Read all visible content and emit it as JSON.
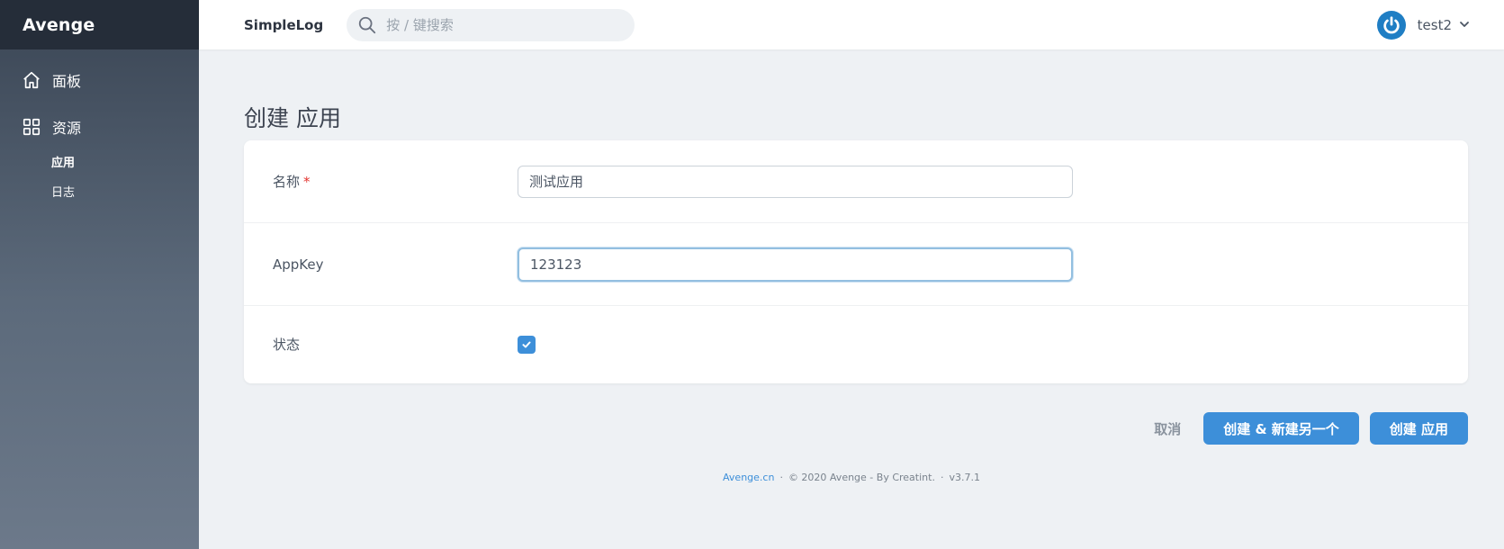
{
  "brand": "Avenge",
  "sidebar": {
    "items": [
      {
        "label": "面板",
        "icon": "home-icon"
      },
      {
        "label": "资源",
        "icon": "grid-icon"
      }
    ],
    "sub_items": [
      {
        "label": "应用",
        "active": true
      },
      {
        "label": "日志",
        "active": false
      }
    ]
  },
  "topbar": {
    "app_name": "SimpleLog",
    "search_placeholder": "按 / 键搜索",
    "user_name": "test2"
  },
  "page": {
    "title": "创建 应用"
  },
  "form": {
    "name_label": "名称",
    "required_mark": "*",
    "name_value": "测试应用",
    "appkey_label": "AppKey",
    "appkey_value": "123123",
    "status_label": "状态",
    "status_checked": true
  },
  "actions": {
    "cancel": "取消",
    "create_another": "创建 & 新建另一个",
    "create": "创建 应用"
  },
  "footer": {
    "link": "Avenge.cn",
    "separator": "·",
    "copyright": "© 2020 Avenge - By Creatint.",
    "version": "v3.7.1"
  },
  "colors": {
    "accent": "#3d8fd9",
    "sidebar_top": "#252d39",
    "required": "#e3342f"
  }
}
